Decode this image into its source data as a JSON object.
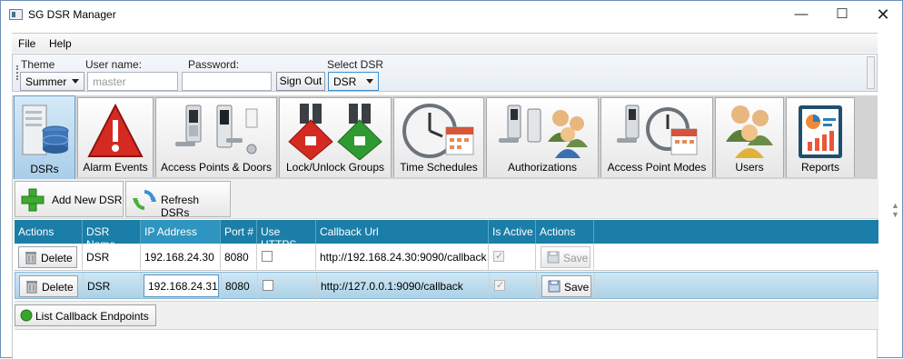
{
  "window": {
    "title": "SG DSR Manager"
  },
  "menu": {
    "file": "File",
    "help": "Help"
  },
  "toolbar": {
    "theme_label": "Theme",
    "theme_value": "Summer",
    "username_label": "User name:",
    "username_placeholder": "master",
    "password_label": "Password:",
    "sign_out": "Sign Out",
    "select_dsr_label": "Select DSR",
    "select_dsr_value": "DSR"
  },
  "tabs": [
    {
      "label": "DSRs",
      "icon": "server-database-icon"
    },
    {
      "label": "Alarm Events",
      "icon": "warning-icon"
    },
    {
      "label": "Access Points & Doors",
      "icon": "door-lock-icon"
    },
    {
      "label": "Lock/Unlock Groups",
      "icon": "lock-groups-icon"
    },
    {
      "label": "Time Schedules",
      "icon": "clock-calendar-icon"
    },
    {
      "label": "Authorizations",
      "icon": "lock-users-icon"
    },
    {
      "label": "Access Point Modes",
      "icon": "lock-calendar-icon"
    },
    {
      "label": "Users",
      "icon": "users-icon"
    },
    {
      "label": "Reports",
      "icon": "report-icon"
    }
  ],
  "actions": {
    "add": "Add New DSR",
    "refresh": "Refresh DSRs",
    "list_callbacks": "List Callback Endpoints"
  },
  "grid": {
    "headers": [
      "Actions",
      "DSR Name",
      "IP Address",
      "Port #",
      "Use HTTPS",
      "Callback Url",
      "Is Active",
      "Actions"
    ],
    "rows": [
      {
        "delete": "Delete",
        "name": "DSR",
        "ip": "192.168.24.30",
        "port": "8080",
        "https": false,
        "callback": "http://192.168.24.30:9090/callback",
        "active": true,
        "save": "Save"
      },
      {
        "delete": "Delete",
        "name": "DSR",
        "ip": "192.168.24.31",
        "port": "8080",
        "https": false,
        "callback": "http://127.0.0.1:9090/callback",
        "active": true,
        "save": "Save"
      }
    ]
  },
  "colors": {
    "header": "#1a7ea8",
    "selected_row": "#abd1e7",
    "active_tab": "#a9cde9"
  }
}
